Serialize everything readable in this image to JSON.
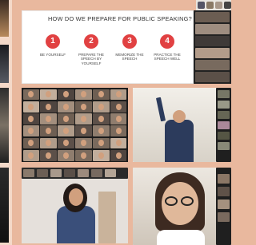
{
  "slide": {
    "title": "HOW DO WE PREPARE FOR PUBLIC SPEAKING?",
    "steps": [
      {
        "number": "1",
        "label": "BE YOURSELF"
      },
      {
        "number": "2",
        "label": "PREPARE THE SPEECH BY YOURSELF"
      },
      {
        "number": "3",
        "label": "MEMORIZE THE SPEECH"
      },
      {
        "number": "4",
        "label": "PRACTICE THE SPEECH WELL"
      }
    ]
  },
  "colors": {
    "background": "#e9b89e",
    "accent_red": "#e14142",
    "gallery_dark": "#1c1c1c"
  },
  "icons": [
    "video-tile",
    "participant-photo"
  ]
}
